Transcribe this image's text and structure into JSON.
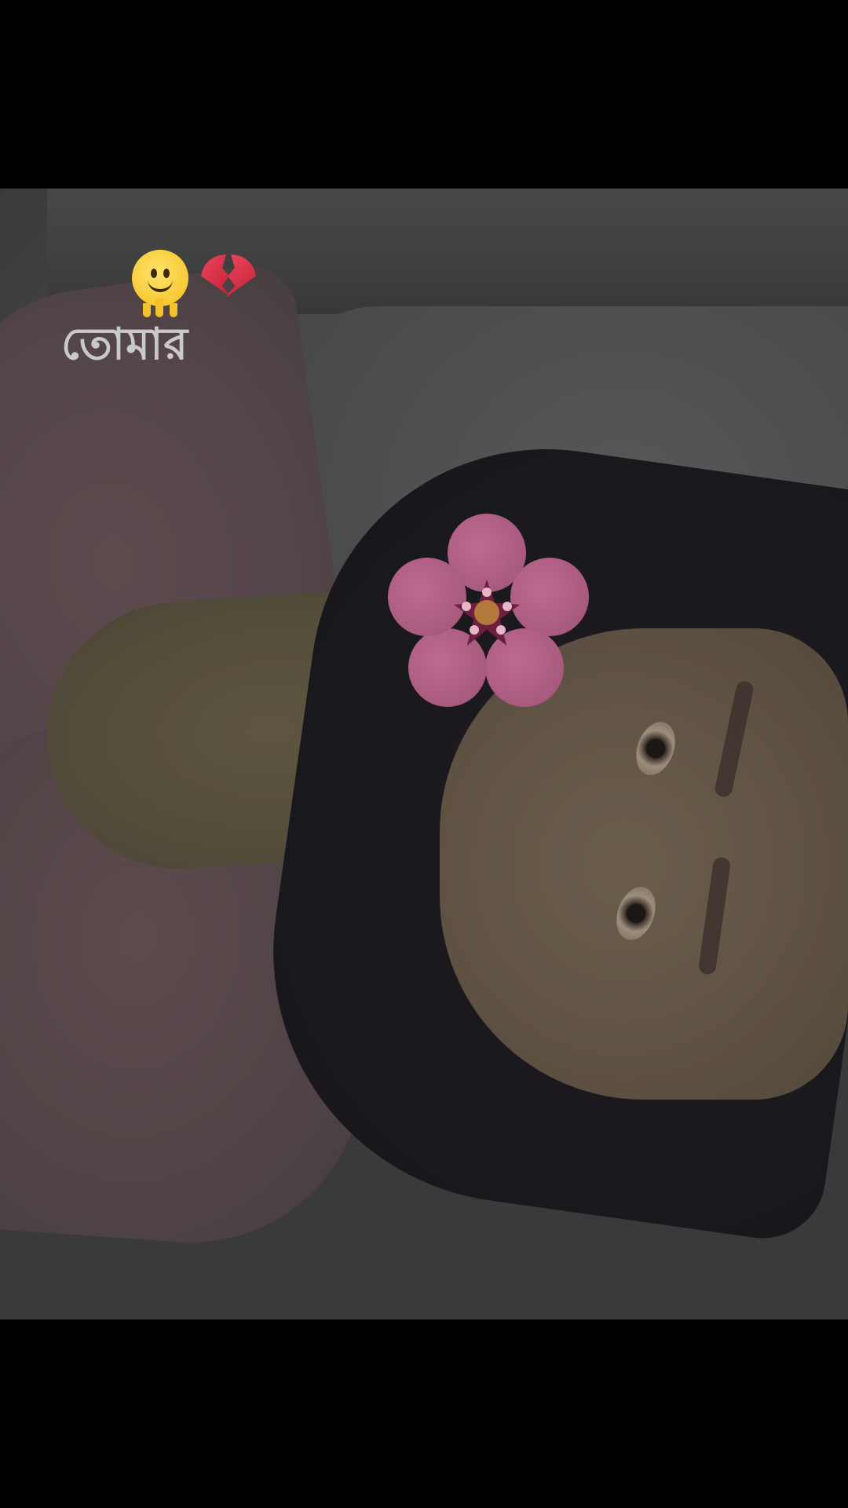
{
  "overlay": {
    "caption": "তোমার",
    "emojis": [
      "melting-face",
      "broken-heart"
    ]
  },
  "video": {
    "sticker": "cherry-blossom-sticker"
  },
  "colors": {
    "letterbox": "#000000",
    "caption_text": "#c9c9c9",
    "sticker_petal": "#a85a7f",
    "sticker_center": "#6e1e3e"
  }
}
